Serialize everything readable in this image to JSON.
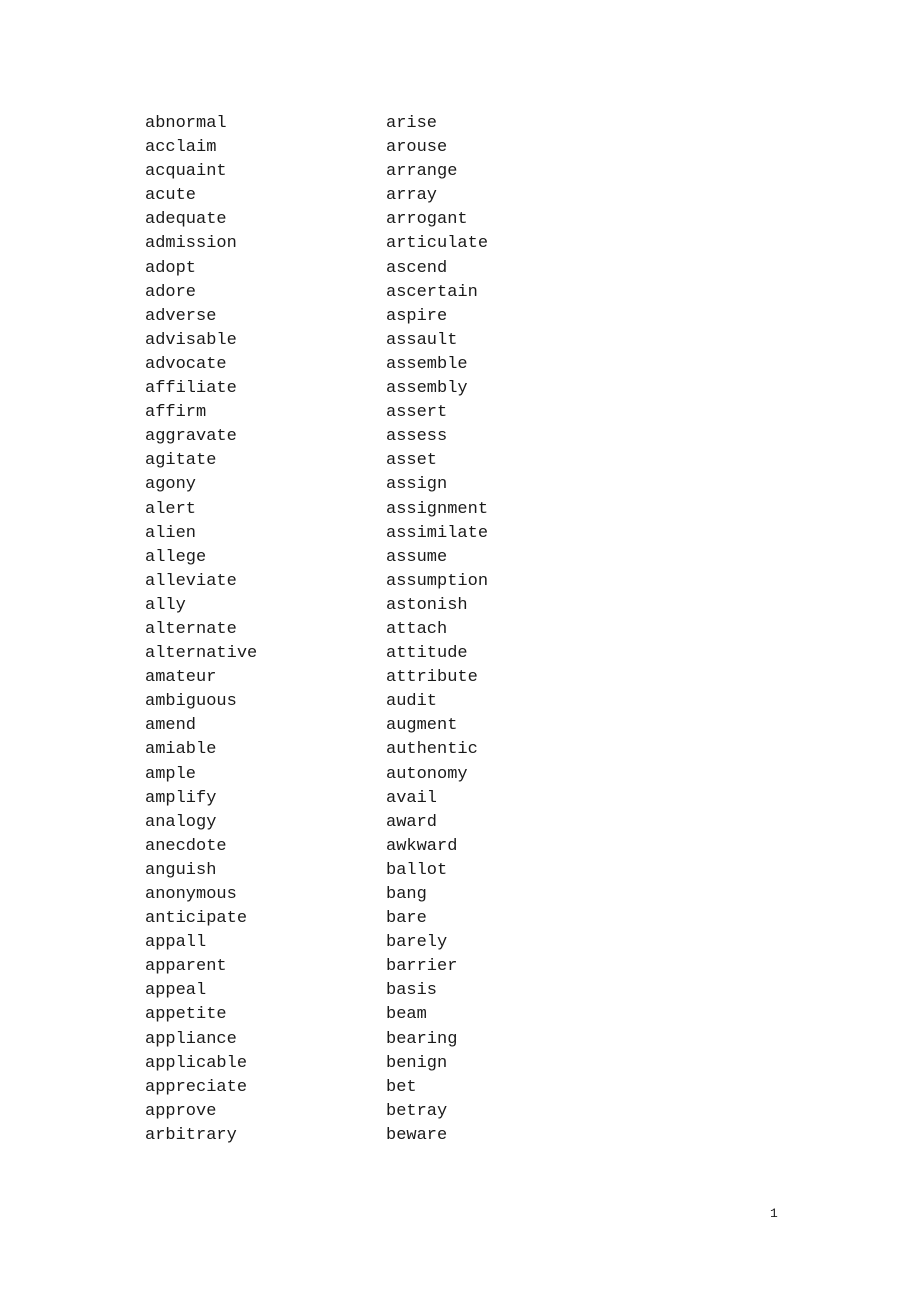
{
  "document": {
    "page_number": "1",
    "background_color": "#ffffff",
    "text_color": "#1a1a1a",
    "columns": [
      {
        "name": "left-column",
        "words": [
          "abnormal",
          "acclaim",
          "acquaint",
          "acute",
          "adequate",
          "admission",
          "adopt",
          "adore",
          "adverse",
          "advisable",
          "advocate",
          "affiliate",
          "affirm",
          "aggravate",
          "agitate",
          "agony",
          "alert",
          "alien",
          "allege",
          "alleviate",
          "ally",
          "alternate",
          "alternative",
          "amateur",
          "ambiguous",
          "amend",
          "amiable",
          "ample",
          "amplify",
          "analogy",
          "anecdote",
          "anguish",
          "anonymous",
          "anticipate",
          "appall",
          "apparent",
          "appeal",
          "appetite",
          "appliance",
          "applicable",
          "appreciate",
          "approve",
          "arbitrary"
        ]
      },
      {
        "name": "right-column",
        "words": [
          "arise",
          "arouse",
          "arrange",
          "array",
          "arrogant",
          "articulate",
          "ascend",
          "ascertain",
          "aspire",
          "assault",
          "assemble",
          "assembly",
          "assert",
          "assess",
          "asset",
          "assign",
          "assignment",
          "assimilate",
          "assume",
          "assumption",
          "astonish",
          "attach",
          "attitude",
          "attribute",
          "audit",
          "augment",
          "authentic",
          "autonomy",
          "avail",
          "award",
          "awkward",
          "ballot",
          "bang",
          "bare",
          "barely",
          "barrier",
          "basis",
          "beam",
          "bearing",
          "benign",
          "bet",
          "betray",
          "beware"
        ]
      }
    ]
  }
}
